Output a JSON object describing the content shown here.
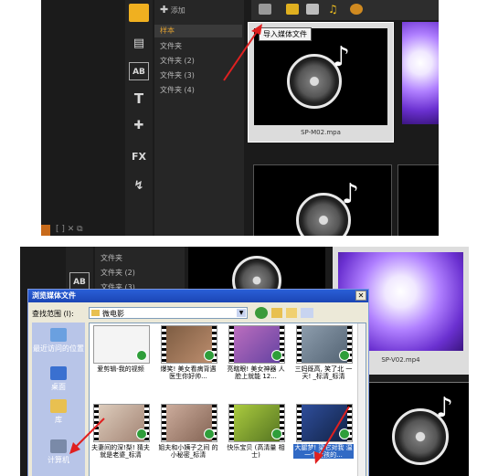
{
  "top_panel": {
    "library": {
      "items": [
        "样本",
        "文件夹",
        "文件夹 (2)",
        "文件夹 (3)",
        "文件夹 (4)"
      ]
    },
    "toolbar": {
      "add_label": "添加",
      "tooltip": "导入媒体文件",
      "icons": [
        "folder-icon",
        "video-icon",
        "image-icon",
        "audio-icon",
        "flash-icon"
      ]
    },
    "sidebar_tools": [
      "media-icon",
      "instant-project-icon",
      "title-icon",
      "T",
      "transition-icon",
      "FX",
      "path-icon"
    ],
    "thumb_caption": "SP-M02.mpa"
  },
  "bottom_panel": {
    "library": {
      "items": [
        "文件夹",
        "文件夹 (2)",
        "文件夹 (3)"
      ]
    },
    "right_caption": "SP-V02.mp4",
    "dialog": {
      "title": "浏览媒体文件",
      "look_in_label": "查找范围 (I):",
      "look_in_value": "微电影",
      "places": [
        "最近访问的位置",
        "桌面",
        "库",
        "计算机"
      ],
      "files": [
        "爱剪辑-我的视频",
        "爆笑! 美女看病背遇 医生你好帅...",
        "亮瞎眼! 美女神器 人脸上就能 12...",
        "三妈既高, 笑了北 一天! _标清_标清",
        "夫妻间的深!梨! 猜夫就是老婆_标清",
        "姐夫和小姨子之间 的小秘密_标清",
        "快乐宝贝 (高清量 相士)",
        "大腿梦! 梁它对我 温一个女孩的..."
      ]
    }
  },
  "colors": {
    "highlight": "#e0a030",
    "dialog_title": "#2a5fd6",
    "selection": "#316ac5",
    "arrow": "#e02020"
  }
}
